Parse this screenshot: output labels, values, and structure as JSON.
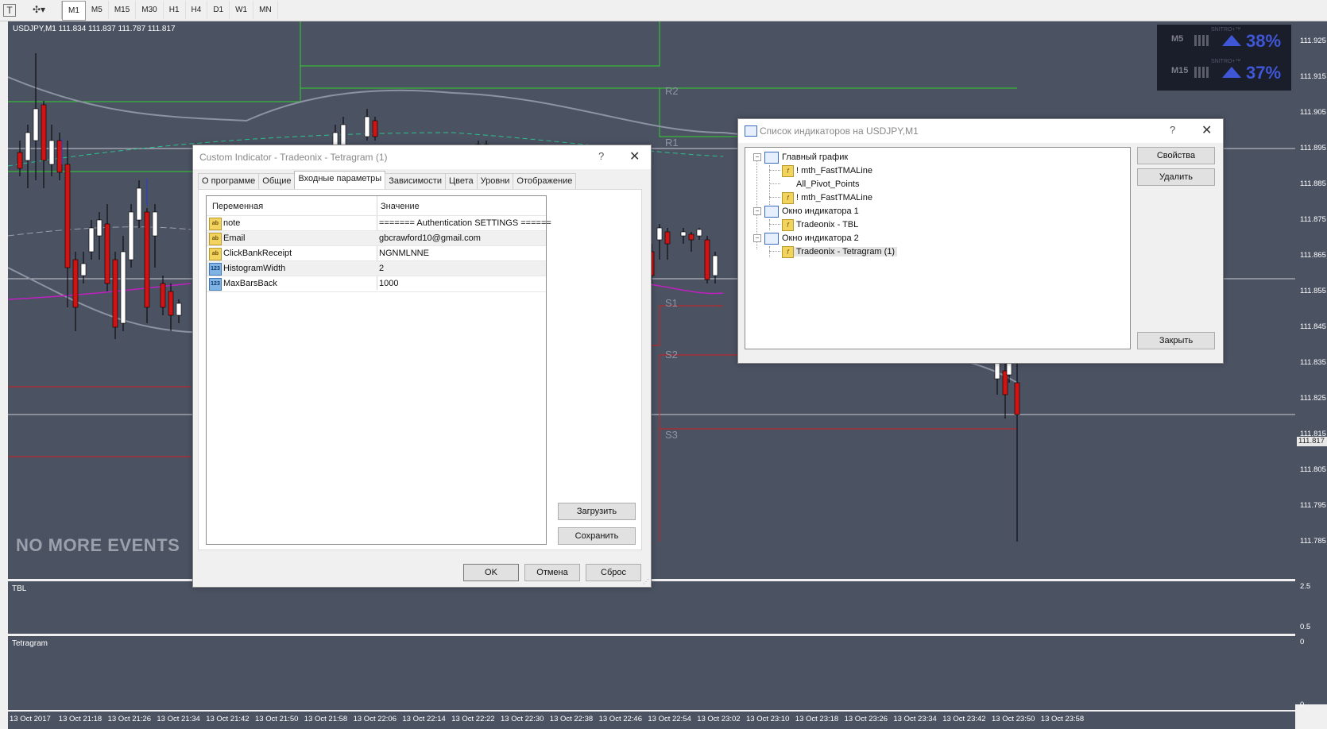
{
  "toolbar": {
    "timeframes": [
      "M1",
      "M5",
      "M15",
      "M30",
      "H1",
      "H4",
      "D1",
      "W1",
      "MN"
    ],
    "active_timeframe": "M1"
  },
  "chart": {
    "symbol_info": "USDJPY,M1  111.834 111.837 111.787 111.817",
    "no_more_events": "NO MORE EVENTS",
    "levels": [
      "R2",
      "R1",
      "S1",
      "S2",
      "S3"
    ],
    "price_ticks": [
      "111.925",
      "111.915",
      "111.905",
      "111.895",
      "111.885",
      "111.875",
      "111.865",
      "111.855",
      "111.845",
      "111.835",
      "111.825",
      "111.815",
      "111.805",
      "111.795",
      "111.785"
    ],
    "current_price": "111.817",
    "colors": {
      "bg": "#4b5262",
      "bull": "#ffffff",
      "bear": "#d01414",
      "pivot_green": "#2fd12f",
      "support_red": "#d02020",
      "band_gray": "#8c93a3",
      "magenta": "#c020c0"
    }
  },
  "subpanels": {
    "tbl": {
      "label": "TBL",
      "axis": [
        "2.5",
        "0.5"
      ]
    },
    "tetragram": {
      "label": "Tetragram",
      "axis": [
        "0",
        "0"
      ]
    }
  },
  "time_axis": [
    "13 Oct 2017",
    "13 Oct 21:18",
    "13 Oct 21:26",
    "13 Oct 21:34",
    "13 Oct 21:42",
    "13 Oct 21:50",
    "13 Oct 21:58",
    "13 Oct 22:06",
    "13 Oct 22:14",
    "13 Oct 22:22",
    "13 Oct 22:30",
    "13 Oct 22:38",
    "13 Oct 22:46",
    "13 Oct 22:54",
    "13 Oct 23:02",
    "13 Oct 23:10",
    "13 Oct 23:18",
    "13 Oct 23:26",
    "13 Oct 23:34",
    "13 Oct 23:42",
    "13 Oct 23:50",
    "13 Oct 23:58"
  ],
  "widget": {
    "brand": "SNITRO+™",
    "rows": [
      {
        "tf": "M5",
        "percent": "38%",
        "direction": "up"
      },
      {
        "tf": "M15",
        "percent": "37%",
        "direction": "up"
      }
    ]
  },
  "indicator_dialog": {
    "title": "Custom Indicator - Tradeonix - Tetragram (1)",
    "help": "?",
    "close": "✕",
    "tabs": [
      "О программе",
      "Общие",
      "Входные параметры",
      "Зависимости",
      "Цвета",
      "Уровни",
      "Отображение"
    ],
    "active_tab": "Входные параметры",
    "columns": {
      "variable": "Переменная",
      "value": "Значение"
    },
    "params": [
      {
        "icon": "ab",
        "name": "note",
        "value": "======= Authentication SETTINGS ======"
      },
      {
        "icon": "ab",
        "name": "Email",
        "value": "gbcrawford10@gmail.com"
      },
      {
        "icon": "ab",
        "name": "ClickBankReceipt",
        "value": "NGNMLNNE"
      },
      {
        "icon": "123",
        "name": "HistogramWidth",
        "value": "2"
      },
      {
        "icon": "123",
        "name": "MaxBarsBack",
        "value": "1000"
      }
    ],
    "load_button": "Загрузить",
    "save_button": "Сохранить",
    "ok_button": "OK",
    "cancel_button": "Отмена",
    "reset_button": "Сброс"
  },
  "indicator_list": {
    "title": "Список индикаторов на USDJPY,M1",
    "help": "?",
    "close": "✕",
    "tree": [
      {
        "label": "Главный график",
        "children": [
          "!   mth_FastTMALine",
          "All_Pivot_Points",
          "!   mth_FastTMALine"
        ]
      },
      {
        "label": "Окно индикатора 1",
        "children": [
          "Tradeonix - TBL"
        ]
      },
      {
        "label": "Окно индикатора 2",
        "children": [
          "Tradeonix - Tetragram (1)"
        ]
      }
    ],
    "properties_button": "Свойства",
    "delete_button": "Удалить",
    "close_button": "Закрыть"
  }
}
